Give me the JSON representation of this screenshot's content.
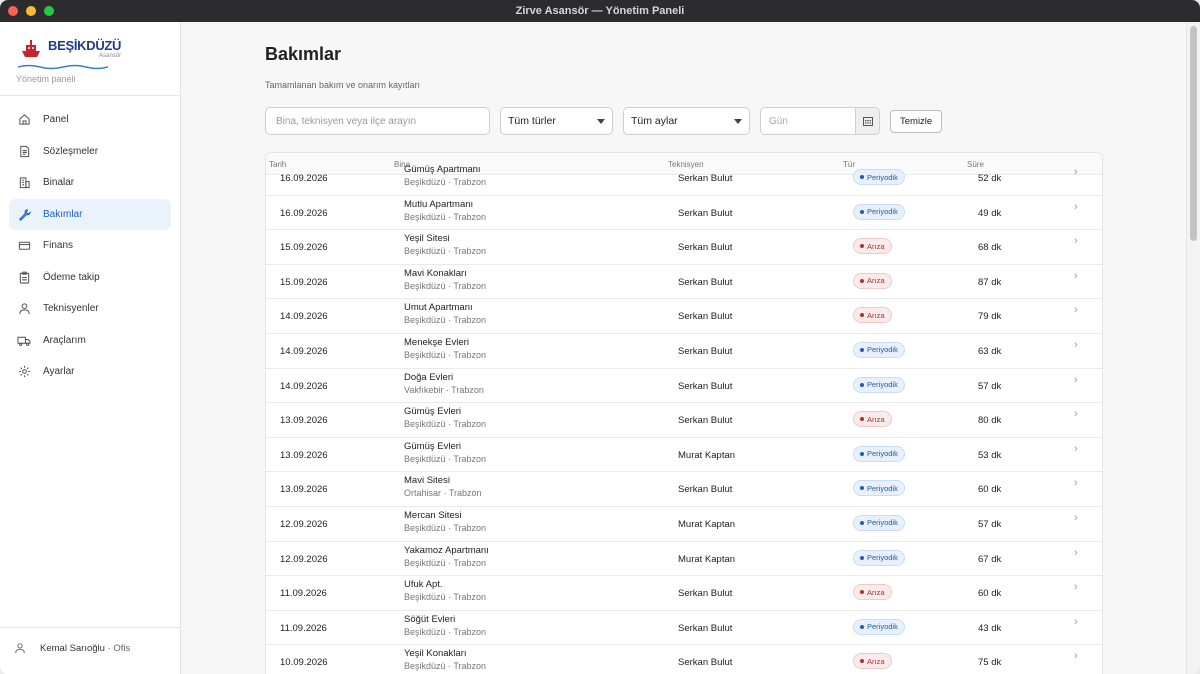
{
  "window": {
    "title": "Zirve Asansör — Yönetim Paneli"
  },
  "brand": {
    "name": "BEŞİKDÜZÜ",
    "sub": "Asansör",
    "panel_label": "Yönetim paneli"
  },
  "sidebar": {
    "items": [
      {
        "label": "Panel",
        "icon": "home-icon",
        "active": false
      },
      {
        "label": "Sözleşmeler",
        "icon": "contract-icon",
        "active": false
      },
      {
        "label": "Binalar",
        "icon": "building-icon",
        "active": false
      },
      {
        "label": "Bakımlar",
        "icon": "wrench-icon",
        "active": true
      },
      {
        "label": "Finans",
        "icon": "card-icon",
        "active": false
      },
      {
        "label": "Ödeme takip",
        "icon": "clipboard-icon",
        "active": false
      },
      {
        "label": "Teknisyenler",
        "icon": "person-icon",
        "active": false
      },
      {
        "label": "Araçlarım",
        "icon": "truck-icon",
        "active": false
      },
      {
        "label": "Ayarlar",
        "icon": "gear-icon",
        "active": false
      }
    ],
    "user": {
      "name": "Kemal Sarıoğlu",
      "role": "· Ofis"
    }
  },
  "page": {
    "title": "Bakımlar",
    "description": "Tamamlanan bakım ve onarım kayıtları"
  },
  "filters": {
    "search_placeholder": "Bina, teknisyen veya ilçe arayın",
    "type_select": "Tüm türler",
    "month_select": "Tüm aylar",
    "day_placeholder": "Gün",
    "clear_label": "Temizle"
  },
  "table": {
    "headers": {
      "date": "Tarih",
      "building": "Bina",
      "technician": "Teknisyen",
      "type": "Tür",
      "duration": "Süre"
    },
    "rows": [
      {
        "date": "16.09.2026",
        "building": "Gümüş Apartmanı",
        "location": "Beşikdüzü · Trabzon",
        "technician": "Serkan Bulut",
        "type": "Periyodik",
        "kind": "p",
        "duration": "52 dk"
      },
      {
        "date": "16.09.2026",
        "building": "Mutlu Apartmanı",
        "location": "Beşikdüzü · Trabzon",
        "technician": "Serkan Bulut",
        "type": "Periyodik",
        "kind": "p",
        "duration": "49 dk"
      },
      {
        "date": "15.09.2026",
        "building": "Yeşil Sitesi",
        "location": "Beşikdüzü · Trabzon",
        "technician": "Serkan Bulut",
        "type": "Arıza",
        "kind": "a",
        "duration": "68 dk"
      },
      {
        "date": "15.09.2026",
        "building": "Mavi Konakları",
        "location": "Beşikdüzü · Trabzon",
        "technician": "Serkan Bulut",
        "type": "Arıza",
        "kind": "a",
        "duration": "87 dk"
      },
      {
        "date": "14.09.2026",
        "building": "Umut Apartmanı",
        "location": "Beşikdüzü · Trabzon",
        "technician": "Serkan Bulut",
        "type": "Arıza",
        "kind": "a",
        "duration": "79 dk"
      },
      {
        "date": "14.09.2026",
        "building": "Menekşe Evleri",
        "location": "Beşikdüzü · Trabzon",
        "technician": "Serkan Bulut",
        "type": "Periyodik",
        "kind": "p",
        "duration": "63 dk"
      },
      {
        "date": "14.09.2026",
        "building": "Doğa Evleri",
        "location": "Vakfıkebir · Trabzon",
        "technician": "Serkan Bulut",
        "type": "Periyodik",
        "kind": "p",
        "duration": "57 dk"
      },
      {
        "date": "13.09.2026",
        "building": "Gümüş Evleri",
        "location": "Beşikdüzü · Trabzon",
        "technician": "Serkan Bulut",
        "type": "Arıza",
        "kind": "a",
        "duration": "80 dk"
      },
      {
        "date": "13.09.2026",
        "building": "Gümüş Evleri",
        "location": "Beşikdüzü · Trabzon",
        "technician": "Murat Kaptan",
        "type": "Periyodik",
        "kind": "p",
        "duration": "53 dk"
      },
      {
        "date": "13.09.2026",
        "building": "Mavi Sitesi",
        "location": "Ortahisar · Trabzon",
        "technician": "Serkan Bulut",
        "type": "Periyodik",
        "kind": "p",
        "duration": "60 dk"
      },
      {
        "date": "12.09.2026",
        "building": "Mercan Sitesi",
        "location": "Beşikdüzü · Trabzon",
        "technician": "Murat Kaptan",
        "type": "Periyodik",
        "kind": "p",
        "duration": "57 dk"
      },
      {
        "date": "12.09.2026",
        "building": "Yakamoz Apartmanı",
        "location": "Beşikdüzü · Trabzon",
        "technician": "Murat Kaptan",
        "type": "Periyodik",
        "kind": "p",
        "duration": "67 dk"
      },
      {
        "date": "11.09.2026",
        "building": "Ufuk Apt.",
        "location": "Beşikdüzü · Trabzon",
        "technician": "Serkan Bulut",
        "type": "Arıza",
        "kind": "a",
        "duration": "60 dk"
      },
      {
        "date": "11.09.2026",
        "building": "Söğüt Evleri",
        "location": "Beşikdüzü · Trabzon",
        "technician": "Serkan Bulut",
        "type": "Periyodik",
        "kind": "p",
        "duration": "43 dk"
      },
      {
        "date": "10.09.2026",
        "building": "Yeşil Konakları",
        "location": "Beşikdüzü · Trabzon",
        "technician": "Serkan Bulut",
        "type": "Arıza",
        "kind": "a",
        "duration": "75 dk"
      }
    ]
  },
  "colors": {
    "accent": "#1d5fb8",
    "periyodik": "#1f5fa8",
    "ariza": "#b33030"
  }
}
